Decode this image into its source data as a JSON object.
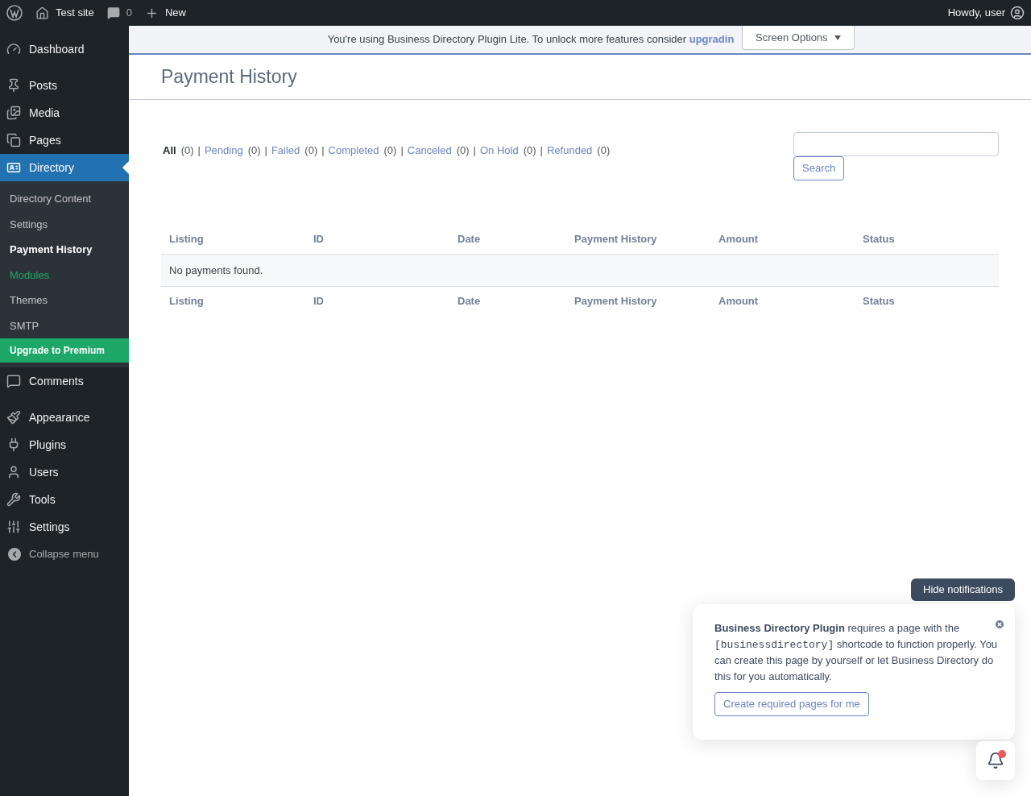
{
  "admin_bar": {
    "site": "Test site",
    "comments": "0",
    "new": "New",
    "greeting": "Howdy, user"
  },
  "sidebar": {
    "groups": [
      {
        "items": [
          {
            "label": "Dashboard",
            "kind": "dashboard",
            "selected": false
          }
        ]
      },
      {
        "items": [
          {
            "label": "Posts",
            "kind": "posts",
            "selected": false
          },
          {
            "label": "Media",
            "kind": "media",
            "selected": false
          },
          {
            "label": "Pages",
            "kind": "pages",
            "selected": false
          },
          {
            "label": "Directory",
            "kind": "directory",
            "selected": true,
            "children": [
              {
                "label": "Directory Content",
                "kind": "link",
                "selected": false
              },
              {
                "label": "Settings",
                "kind": "link",
                "selected": false
              },
              {
                "label": "Payment History",
                "kind": "link",
                "selected": true
              },
              {
                "label": "Modules",
                "kind": "highlight",
                "selected": false
              },
              {
                "label": "Themes",
                "kind": "link",
                "selected": false
              },
              {
                "label": "SMTP",
                "kind": "link",
                "selected": false
              },
              {
                "label": "Upgrade to Premium",
                "kind": "premium",
                "selected": false
              }
            ]
          },
          {
            "label": "Comments",
            "kind": "comments",
            "selected": false
          }
        ]
      },
      {
        "items": [
          {
            "label": "Appearance",
            "kind": "appearance",
            "selected": false
          },
          {
            "label": "Plugins",
            "kind": "plugins",
            "selected": false
          },
          {
            "label": "Users",
            "kind": "users",
            "selected": false
          },
          {
            "label": "Tools",
            "kind": "tools",
            "selected": false
          },
          {
            "label": "Settings",
            "kind": "settings",
            "selected": false
          }
        ]
      }
    ],
    "collapse": "Collapse menu"
  },
  "notice": {
    "text": "You're using Business Directory Plugin Lite. To unlock more features consider",
    "link": "upgradin"
  },
  "screen_options": "Screen Options",
  "page_title": "Payment History",
  "filters": [
    {
      "label": "All",
      "count": "(0)",
      "selected": true
    },
    {
      "separator": "|",
      "label": "Pending",
      "count": "(0)",
      "selected": false
    },
    {
      "separator": "|",
      "label": "Failed",
      "count": "(0)",
      "selected": false
    },
    {
      "separator": "|",
      "label": "Completed",
      "count": "(0)",
      "selected": false
    },
    {
      "separator": "|",
      "label": "Canceled",
      "count": "(0)",
      "selected": false
    },
    {
      "separator": "|",
      "label": "On Hold",
      "count": "(0)",
      "selected": false
    },
    {
      "separator": "|",
      "label": "Refunded",
      "count": "(0)",
      "selected": false
    }
  ],
  "search": {
    "button": "Search"
  },
  "table": {
    "columns": [
      "Listing",
      "ID",
      "Date",
      "Payment History",
      "Amount",
      "Status"
    ],
    "empty": "No payments found.",
    "footer_columns": [
      "Listing",
      "ID",
      "Date",
      "Payment History",
      "Amount",
      "Status"
    ]
  },
  "notifications": {
    "hide": "Hide notifications",
    "message": {
      "intro": "**Business Directory Plugin** requires a page with the",
      "code": "[businessdirectory]",
      "rest": "shortcode to function properly. You can create this page by yourself or let Business Directory do this for you automatically."
    },
    "action": "Create required pages for me",
    "unread": true
  }
}
